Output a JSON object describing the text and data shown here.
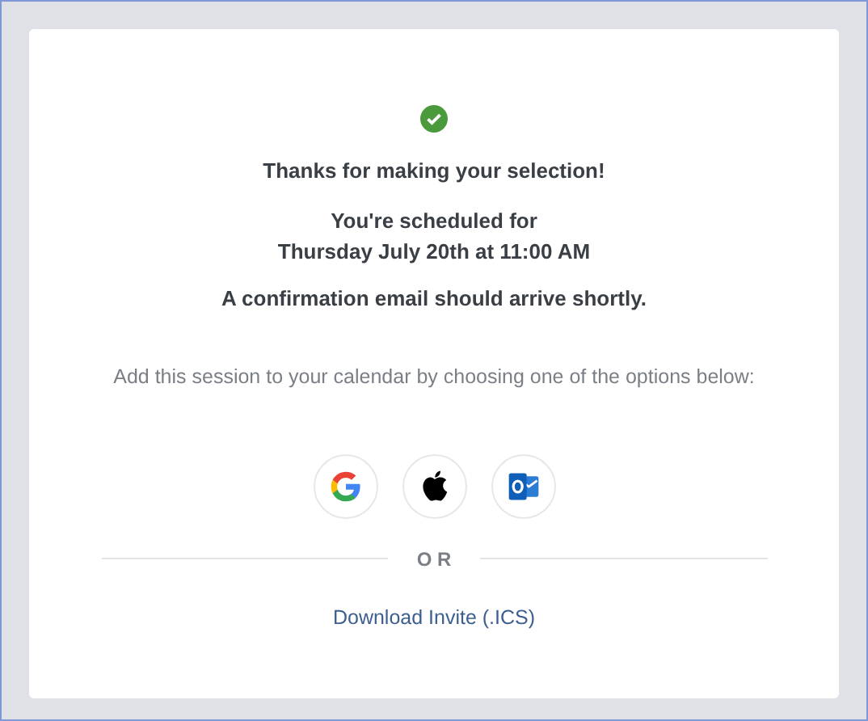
{
  "confirmation": {
    "title": "Thanks for making your selection!",
    "scheduled_label": "You're scheduled for",
    "scheduled_time": "Thursday July 20th at 11:00 AM",
    "email_note": "A confirmation email should arrive shortly."
  },
  "calendar": {
    "prompt": "Add this session to your calendar by choosing one of the options below:",
    "options": [
      {
        "kind": "google"
      },
      {
        "kind": "apple"
      },
      {
        "kind": "outlook"
      }
    ],
    "separator": "O R",
    "download_link": "Download Invite (.ICS)"
  }
}
